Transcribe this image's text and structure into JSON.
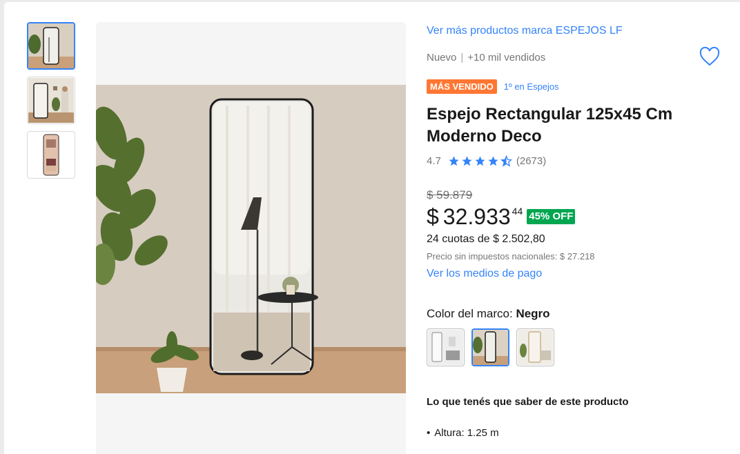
{
  "thumbnails": [
    {
      "name": "thumbnail-mirror-front",
      "active": true
    },
    {
      "name": "thumbnail-mirror-room",
      "active": false
    },
    {
      "name": "thumbnail-mirror-bedroom",
      "active": false
    }
  ],
  "product": {
    "brand_link": "Ver más productos marca ESPEJOS LF",
    "condition": "Nuevo",
    "sold": "+10 mil vendidos",
    "badge_best_seller": "MÁS VENDIDO",
    "badge_rank": "1º en Espejos",
    "title": "Espejo Rectangular 125x45 Cm Moderno Deco",
    "rating": "4.7",
    "stars": 4.5,
    "reviews": "(2673)",
    "original_price": "$ 59.879",
    "currency": "$",
    "price": "32.933",
    "price_cents": "44",
    "discount": "45% OFF",
    "installments": "24 cuotas de $ 2.502,80",
    "tax_note": "Precio sin impuestos nacionales: $ 27.218",
    "payment_link": "Ver los medios de pago",
    "color_label": "Color del marco: ",
    "color_value": "Negro",
    "features_title": "Lo que tenés que saber de este producto",
    "features": [
      "Altura: 1.25 m"
    ]
  },
  "colors": {
    "accent": "#3483fa",
    "best_seller": "#ff7733",
    "discount": "#00a650"
  }
}
